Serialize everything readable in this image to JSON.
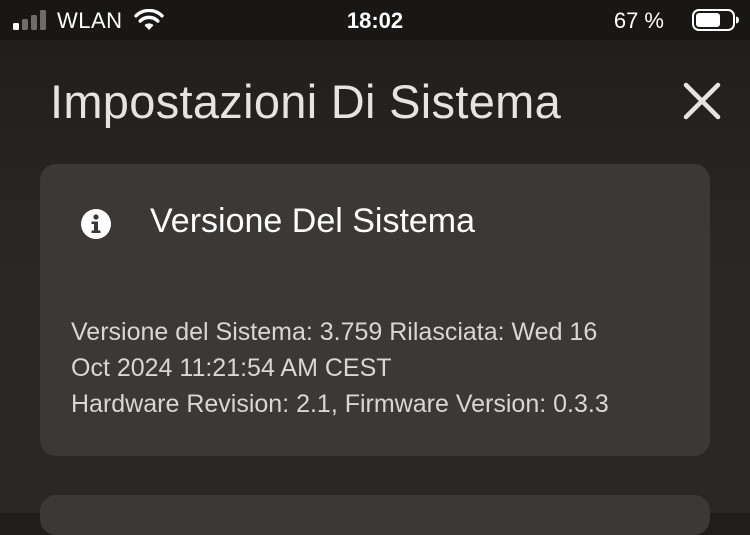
{
  "status_bar": {
    "carrier": "WLAN",
    "time": "18:02",
    "battery_percent": "67 %",
    "signal_icon": "cellular-signal-icon",
    "wifi_icon": "wifi-icon",
    "battery_icon": "battery-icon",
    "signal_bars_active": 1,
    "signal_bars_total": 4,
    "battery_level": 0.67
  },
  "header": {
    "title": "Impostazioni Di Sistema",
    "close_icon": "close-icon"
  },
  "card": {
    "icon": "info-icon",
    "title": "Versione Del Sistema",
    "lines": [
      "Versione del Sistema: 3.759 Rilasciata: Wed 16",
      "Oct 2024 11:21:54 AM CEST",
      "Hardware Revision: 2.1, Firmware Version: 0.3.3"
    ]
  },
  "colors": {
    "background": "#262321",
    "status_bar": "#181716",
    "card": "#3b3836",
    "text": "#ffffff",
    "body_text": "#d9d6d3"
  }
}
